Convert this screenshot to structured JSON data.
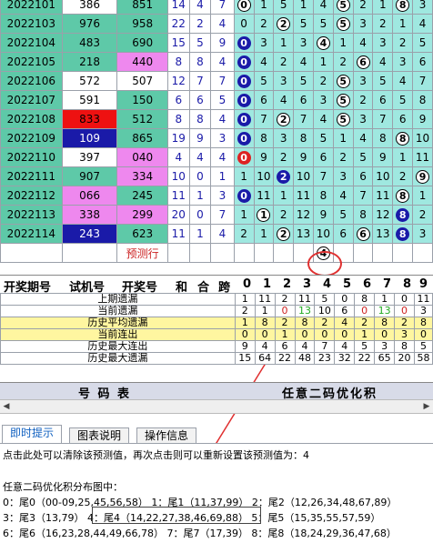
{
  "rows": [
    {
      "period": "2022101",
      "trial": "386",
      "win": "851",
      "h": "14",
      "k": "4",
      "s": "7",
      "trial_bg": "#fff",
      "win_bg": "#5ec9a8",
      "trial_fg": "#000",
      "win_fg": "#000",
      "digits": [
        {
          "v": "0",
          "t": "open"
        },
        {
          "v": "1",
          "t": ""
        },
        {
          "v": "5",
          "t": ""
        },
        {
          "v": "1",
          "t": ""
        },
        {
          "v": "4",
          "t": ""
        },
        {
          "v": "5",
          "t": "open"
        },
        {
          "v": "2",
          "t": ""
        },
        {
          "v": "1",
          "t": ""
        },
        {
          "v": "8",
          "t": "open"
        },
        {
          "v": "3",
          "t": ""
        }
      ]
    },
    {
      "period": "2022103",
      "trial": "976",
      "win": "958",
      "h": "22",
      "k": "2",
      "s": "4",
      "trial_bg": "#5ec9a8",
      "win_bg": "#5ec9a8",
      "trial_fg": "#000",
      "win_fg": "#000",
      "digits": [
        {
          "v": "0",
          "t": ""
        },
        {
          "v": "2",
          "t": ""
        },
        {
          "v": "2",
          "t": "open"
        },
        {
          "v": "5",
          "t": ""
        },
        {
          "v": "5",
          "t": ""
        },
        {
          "v": "5",
          "t": "open"
        },
        {
          "v": "3",
          "t": ""
        },
        {
          "v": "2",
          "t": ""
        },
        {
          "v": "1",
          "t": ""
        },
        {
          "v": "4",
          "t": ""
        }
      ]
    },
    {
      "period": "2022104",
      "trial": "483",
      "win": "690",
      "h": "15",
      "k": "5",
      "s": "9",
      "trial_bg": "#5ec9a8",
      "win_bg": "#5ec9a8",
      "trial_fg": "#000",
      "win_fg": "#000",
      "digits": [
        {
          "v": "0",
          "t": "blue"
        },
        {
          "v": "3",
          "t": ""
        },
        {
          "v": "1",
          "t": ""
        },
        {
          "v": "3",
          "t": ""
        },
        {
          "v": "4",
          "t": "open"
        },
        {
          "v": "1",
          "t": ""
        },
        {
          "v": "4",
          "t": ""
        },
        {
          "v": "3",
          "t": ""
        },
        {
          "v": "2",
          "t": ""
        },
        {
          "v": "5",
          "t": ""
        }
      ]
    },
    {
      "period": "2022105",
      "trial": "218",
      "win": "440",
      "h": "8",
      "k": "8",
      "s": "4",
      "trial_bg": "#5ec9a8",
      "win_bg": "#ee88ee",
      "trial_fg": "#000",
      "win_fg": "#000",
      "digits": [
        {
          "v": "0",
          "t": "blue"
        },
        {
          "v": "4",
          "t": ""
        },
        {
          "v": "2",
          "t": ""
        },
        {
          "v": "4",
          "t": ""
        },
        {
          "v": "1",
          "t": ""
        },
        {
          "v": "2",
          "t": ""
        },
        {
          "v": "6",
          "t": "open"
        },
        {
          "v": "4",
          "t": ""
        },
        {
          "v": "3",
          "t": ""
        },
        {
          "v": "6",
          "t": ""
        }
      ]
    },
    {
      "period": "2022106",
      "trial": "572",
      "win": "507",
      "h": "12",
      "k": "7",
      "s": "7",
      "trial_bg": "#fff",
      "win_bg": "#fff",
      "trial_fg": "#000",
      "win_fg": "#000",
      "digits": [
        {
          "v": "0",
          "t": "blue"
        },
        {
          "v": "5",
          "t": ""
        },
        {
          "v": "3",
          "t": ""
        },
        {
          "v": "5",
          "t": ""
        },
        {
          "v": "2",
          "t": ""
        },
        {
          "v": "5",
          "t": "open"
        },
        {
          "v": "3",
          "t": ""
        },
        {
          "v": "5",
          "t": ""
        },
        {
          "v": "4",
          "t": ""
        },
        {
          "v": "7",
          "t": ""
        }
      ]
    },
    {
      "period": "2022107",
      "trial": "591",
      "win": "150",
      "h": "6",
      "k": "6",
      "s": "5",
      "trial_bg": "#fff",
      "win_bg": "#5ec9a8",
      "trial_fg": "#000",
      "win_fg": "#000",
      "digits": [
        {
          "v": "0",
          "t": "blue"
        },
        {
          "v": "6",
          "t": ""
        },
        {
          "v": "4",
          "t": ""
        },
        {
          "v": "6",
          "t": ""
        },
        {
          "v": "3",
          "t": ""
        },
        {
          "v": "5",
          "t": "open"
        },
        {
          "v": "2",
          "t": ""
        },
        {
          "v": "6",
          "t": ""
        },
        {
          "v": "5",
          "t": ""
        },
        {
          "v": "8",
          "t": ""
        }
      ]
    },
    {
      "period": "2022108",
      "trial": "833",
      "win": "512",
      "h": "8",
      "k": "8",
      "s": "4",
      "trial_bg": "#ee1111",
      "win_bg": "#5ec9a8",
      "trial_fg": "#000",
      "win_fg": "#000",
      "digits": [
        {
          "v": "0",
          "t": "blue"
        },
        {
          "v": "7",
          "t": ""
        },
        {
          "v": "2",
          "t": "open"
        },
        {
          "v": "7",
          "t": ""
        },
        {
          "v": "4",
          "t": ""
        },
        {
          "v": "5",
          "t": "open"
        },
        {
          "v": "3",
          "t": ""
        },
        {
          "v": "7",
          "t": ""
        },
        {
          "v": "6",
          "t": ""
        },
        {
          "v": "9",
          "t": ""
        }
      ]
    },
    {
      "period": "2022109",
      "trial": "109",
      "win": "865",
      "h": "19",
      "k": "9",
      "s": "3",
      "trial_bg": "#1a1aa8",
      "win_bg": "#5ec9a8",
      "trial_fg": "#fff",
      "win_fg": "#000",
      "digits": [
        {
          "v": "0",
          "t": "blue"
        },
        {
          "v": "8",
          "t": ""
        },
        {
          "v": "3",
          "t": ""
        },
        {
          "v": "8",
          "t": ""
        },
        {
          "v": "5",
          "t": ""
        },
        {
          "v": "1",
          "t": ""
        },
        {
          "v": "4",
          "t": ""
        },
        {
          "v": "8",
          "t": ""
        },
        {
          "v": "8",
          "t": "open"
        },
        {
          "v": "10",
          "t": ""
        }
      ]
    },
    {
      "period": "2022110",
      "trial": "397",
      "win": "040",
      "h": "4",
      "k": "4",
      "s": "4",
      "trial_bg": "#fff",
      "win_bg": "#ee88ee",
      "trial_fg": "#000",
      "win_fg": "#000",
      "digits": [
        {
          "v": "0",
          "t": "red"
        },
        {
          "v": "9",
          "t": ""
        },
        {
          "v": "2",
          "t": ""
        },
        {
          "v": "9",
          "t": ""
        },
        {
          "v": "6",
          "t": ""
        },
        {
          "v": "2",
          "t": ""
        },
        {
          "v": "5",
          "t": ""
        },
        {
          "v": "9",
          "t": ""
        },
        {
          "v": "1",
          "t": ""
        },
        {
          "v": "11",
          "t": ""
        }
      ]
    },
    {
      "period": "2022111",
      "trial": "907",
      "win": "334",
      "h": "10",
      "k": "0",
      "s": "1",
      "trial_bg": "#5ec9a8",
      "win_bg": "#ee88ee",
      "trial_fg": "#000",
      "win_fg": "#000",
      "digits": [
        {
          "v": "1",
          "t": ""
        },
        {
          "v": "10",
          "t": ""
        },
        {
          "v": "2",
          "t": "blue"
        },
        {
          "v": "10",
          "t": ""
        },
        {
          "v": "7",
          "t": ""
        },
        {
          "v": "3",
          "t": ""
        },
        {
          "v": "6",
          "t": ""
        },
        {
          "v": "10",
          "t": ""
        },
        {
          "v": "2",
          "t": ""
        },
        {
          "v": "9",
          "t": "open"
        }
      ]
    },
    {
      "period": "2022112",
      "trial": "066",
      "win": "245",
      "h": "11",
      "k": "1",
      "s": "3",
      "trial_bg": "#ee88ee",
      "win_bg": "#5ec9a8",
      "trial_fg": "#000",
      "win_fg": "#000",
      "digits": [
        {
          "v": "0",
          "t": "blue"
        },
        {
          "v": "11",
          "t": ""
        },
        {
          "v": "1",
          "t": ""
        },
        {
          "v": "11",
          "t": ""
        },
        {
          "v": "8",
          "t": ""
        },
        {
          "v": "4",
          "t": ""
        },
        {
          "v": "7",
          "t": ""
        },
        {
          "v": "11",
          "t": ""
        },
        {
          "v": "8",
          "t": "open"
        },
        {
          "v": "1",
          "t": ""
        }
      ]
    },
    {
      "period": "2022113",
      "trial": "338",
      "win": "299",
      "h": "20",
      "k": "0",
      "s": "7",
      "trial_bg": "#ee88ee",
      "win_bg": "#ee88ee",
      "trial_fg": "#000",
      "win_fg": "#000",
      "digits": [
        {
          "v": "1",
          "t": ""
        },
        {
          "v": "1",
          "t": "open"
        },
        {
          "v": "2",
          "t": ""
        },
        {
          "v": "12",
          "t": ""
        },
        {
          "v": "9",
          "t": ""
        },
        {
          "v": "5",
          "t": ""
        },
        {
          "v": "8",
          "t": ""
        },
        {
          "v": "12",
          "t": ""
        },
        {
          "v": "8",
          "t": "blue"
        },
        {
          "v": "2",
          "t": ""
        }
      ]
    },
    {
      "period": "2022114",
      "trial": "243",
      "win": "623",
      "h": "11",
      "k": "1",
      "s": "4",
      "trial_bg": "#1a1aa8",
      "win_bg": "#5ec9a8",
      "trial_fg": "#fff",
      "win_fg": "#000",
      "digits": [
        {
          "v": "2",
          "t": ""
        },
        {
          "v": "1",
          "t": ""
        },
        {
          "v": "2",
          "t": "open"
        },
        {
          "v": "13",
          "t": ""
        },
        {
          "v": "10",
          "t": ""
        },
        {
          "v": "6",
          "t": ""
        },
        {
          "v": "6",
          "t": "open"
        },
        {
          "v": "13",
          "t": ""
        },
        {
          "v": "8",
          "t": "blue"
        },
        {
          "v": "3",
          "t": ""
        }
      ]
    }
  ],
  "predict_label": "预测行",
  "predicted_value": "4",
  "header": {
    "period": "开奖期号",
    "trial": "试机号",
    "win": "开奖号",
    "h": "和",
    "k": "合",
    "s": "跨",
    "digits": [
      "0",
      "1",
      "2",
      "3",
      "4",
      "5",
      "6",
      "7",
      "8",
      "9"
    ]
  },
  "stats": [
    {
      "label": "上期遗漏",
      "bg": "#ffffff",
      "vals": [
        "1",
        "11",
        "2",
        "11",
        "5",
        "0",
        "8",
        "1",
        "0",
        "11"
      ]
    },
    {
      "label": "当前遗漏",
      "bg": "#ffffff",
      "vals": [
        "2",
        "1",
        "0",
        "13",
        "10",
        "6",
        "0",
        "13",
        "0",
        "3"
      ]
    },
    {
      "label": "历史平均遗漏",
      "bg": "#fff6a0",
      "vals": [
        "1",
        "8",
        "2",
        "8",
        "2",
        "4",
        "2",
        "8",
        "2",
        "8"
      ]
    },
    {
      "label": "当前连出",
      "bg": "#fff6a0",
      "vals": [
        "0",
        "0",
        "1",
        "0",
        "0",
        "0",
        "1",
        "0",
        "3",
        "0"
      ]
    },
    {
      "label": "历史最大连出",
      "bg": "#ffffff",
      "vals": [
        "9",
        "4",
        "6",
        "4",
        "7",
        "4",
        "5",
        "3",
        "8",
        "5"
      ]
    },
    {
      "label": "历史最大遗漏",
      "bg": "#ffffff",
      "vals": [
        "15",
        "64",
        "22",
        "48",
        "23",
        "32",
        "22",
        "65",
        "20",
        "58"
      ]
    }
  ],
  "footer": {
    "left": "号 码 表",
    "right": "任意二码优化积"
  },
  "tabs": [
    "即时提示",
    "图表说明",
    "操作信息"
  ],
  "info": {
    "line1": "点击此处可以清除该预测值，再次点击则可以重新设置该预测值为：4",
    "line2": "任意二码优化积分布图中：",
    "line3": "0：尾0（00-09,25,45,56,58） 1：尾1（11,37,99） 2：尾2（12,26,34,48,67,89）",
    "line4": "3：尾3（13,79） 4：尾4（14,22,27,38,46,69,88） 5：尾5（15,35,55,57,59）",
    "line5": "6：尾6（16,23,28,44,49,66,78） 7：尾7（17,39） 8：尾8（18,24,29,36,47,68）"
  }
}
